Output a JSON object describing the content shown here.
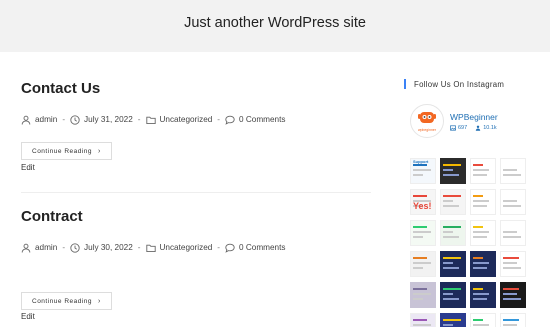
{
  "header": {
    "tagline": "Just another WordPress site"
  },
  "posts": [
    {
      "title": "Contact Us",
      "author": "admin",
      "date": "July 31, 2022",
      "category": "Uncategorized",
      "comments": "0 Comments",
      "continue_label": "Continue Reading",
      "edit_label": "Edit"
    },
    {
      "title": "Contract",
      "author": "admin",
      "date": "July 30, 2022",
      "category": "Uncategorized",
      "comments": "0 Comments",
      "continue_label": "Continue Reading",
      "edit_label": "Edit"
    }
  ],
  "sidebar": {
    "widget_title": "Follow Us On Instagram",
    "profile": {
      "name": "WPBeginner",
      "posts": "697",
      "followers": "10.1k",
      "avatar_text": "wpbeginner"
    },
    "tiles": [
      {
        "bg": "#f4f8fc",
        "accent": "#1e73be",
        "text": "Support"
      },
      {
        "bg": "#2b2b2b",
        "accent": "#f5b800"
      },
      {
        "bg": "#ffffff",
        "accent": "#e94b3c"
      },
      {
        "bg": "#ffffff",
        "accent": "#ffffff"
      },
      {
        "bg": "#f6f6f6",
        "accent": "#e8473a",
        "text": "Yes!"
      },
      {
        "bg": "#f5f5f5",
        "accent": "#e94b3c"
      },
      {
        "bg": "#ffffff",
        "accent": "#f39c12"
      },
      {
        "bg": "#ffffff",
        "accent": "#ffffff"
      },
      {
        "bg": "#f4faf4",
        "accent": "#2ecc71"
      },
      {
        "bg": "#eef6ee",
        "accent": "#27ae60"
      },
      {
        "bg": "#ffffff",
        "accent": "#f1c40f"
      },
      {
        "bg": "#ffffff",
        "accent": "#ffffff"
      },
      {
        "bg": "#f2f2f2",
        "accent": "#e67e22"
      },
      {
        "bg": "#1d2a5a",
        "accent": "#f1c40f"
      },
      {
        "bg": "#1d2a5a",
        "accent": "#e67e22"
      },
      {
        "bg": "#ffffff",
        "accent": "#e94b3c"
      },
      {
        "bg": "#c8c3d6",
        "accent": "#7a6f9b"
      },
      {
        "bg": "#1d2a5a",
        "accent": "#2ecc71"
      },
      {
        "bg": "#1d2a5a",
        "accent": "#f1c40f"
      },
      {
        "bg": "#1a1a1a",
        "accent": "#e74c3c"
      },
      {
        "bg": "#ece8f4",
        "accent": "#9b59b6"
      },
      {
        "bg": "#2a3b8f",
        "accent": "#f1c40f"
      },
      {
        "bg": "#ffffff",
        "accent": "#2ecc71"
      },
      {
        "bg": "#ffffff",
        "accent": "#3498db"
      }
    ]
  }
}
